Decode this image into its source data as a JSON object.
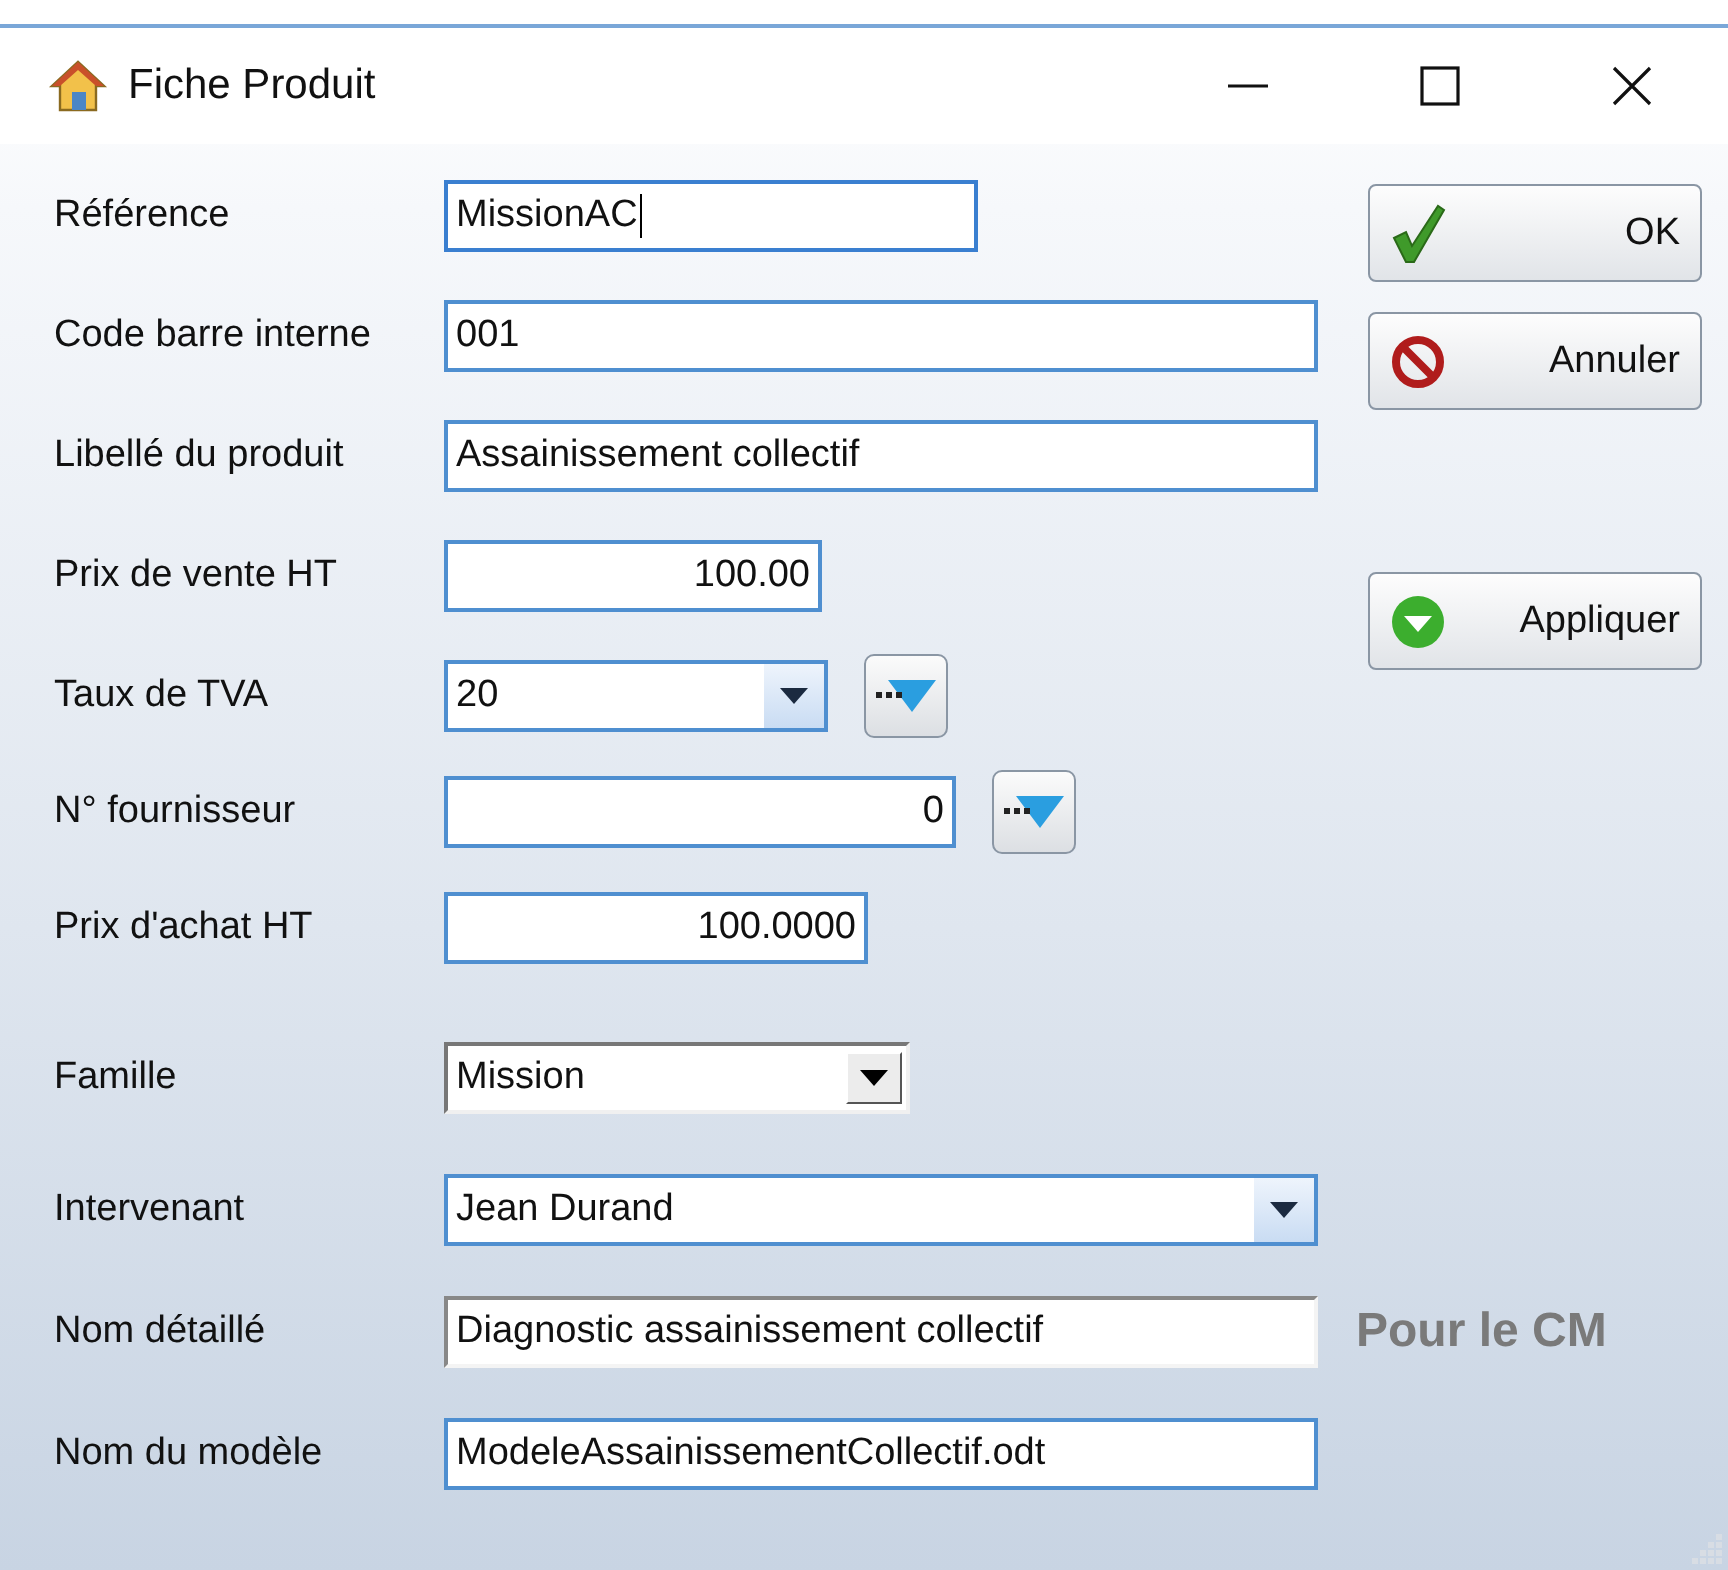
{
  "window": {
    "title": "Fiche Produit"
  },
  "fields": [
    {
      "label": "Référence",
      "kind": "text",
      "value": "MissionAC",
      "focused": true
    },
    {
      "label": "Code barre interne",
      "kind": "text",
      "value": "001"
    },
    {
      "label": "Libellé du produit",
      "kind": "text",
      "value": "Assainissement collectif"
    },
    {
      "label": "Prix de vente HT",
      "kind": "number",
      "value": "100.00"
    },
    {
      "label": "Taux de TVA",
      "kind": "combo",
      "value": "20",
      "lookup": true
    },
    {
      "label": "N° fournisseur",
      "kind": "number",
      "value": "0",
      "lookup": true
    },
    {
      "label": "Prix d'achat HT",
      "kind": "number",
      "value": "100.0000"
    },
    {
      "label": "Famille",
      "kind": "classic-combo",
      "value": "Mission"
    },
    {
      "label": "Intervenant",
      "kind": "combo",
      "value": "Jean Durand"
    },
    {
      "label": "Nom détaillé",
      "kind": "sunken",
      "value": "Diagnostic assainissement collectif",
      "note": "Pour le CM"
    },
    {
      "label": "Nom du modèle",
      "kind": "text",
      "value": "ModeleAssainissementCollectif.odt"
    }
  ],
  "buttons": [
    {
      "label": "OK",
      "kind": "ok"
    },
    {
      "label": "Annuler",
      "kind": "cancel"
    },
    {
      "label": "Appliquer",
      "kind": "apply"
    }
  ]
}
